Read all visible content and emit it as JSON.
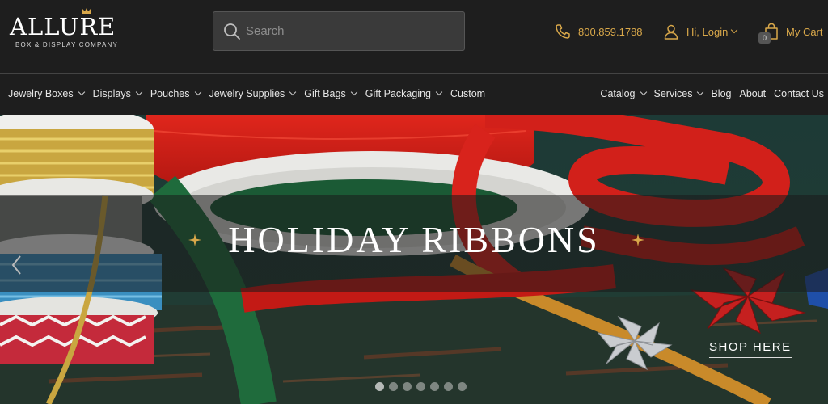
{
  "brand": {
    "name": "ALLURE",
    "tagline": "BOX & DISPLAY COMPANY",
    "accent_color": "#d9a84a"
  },
  "search": {
    "placeholder": "Search",
    "icon": "search-icon"
  },
  "header_utilities": {
    "phone": "800.859.1788",
    "login": "Hi, Login",
    "cart": "My Cart",
    "cart_count": "0"
  },
  "nav": {
    "left": [
      {
        "label": "Jewelry Boxes",
        "dropdown": true
      },
      {
        "label": "Displays",
        "dropdown": true
      },
      {
        "label": "Pouches",
        "dropdown": true
      },
      {
        "label": "Jewelry Supplies",
        "dropdown": true
      },
      {
        "label": "Gift Bags",
        "dropdown": true
      },
      {
        "label": "Gift Packaging",
        "dropdown": true
      },
      {
        "label": "Custom",
        "dropdown": false
      }
    ],
    "right": [
      {
        "label": "Catalog",
        "dropdown": true
      },
      {
        "label": "Services",
        "dropdown": true
      },
      {
        "label": "Blog",
        "dropdown": false
      },
      {
        "label": "About",
        "dropdown": false
      },
      {
        "label": "Contact Us",
        "dropdown": false
      }
    ]
  },
  "hero": {
    "title": "HOLIDAY RIBBONS",
    "cta": "SHOP HERE",
    "slides_total": 7,
    "active_slide": 1
  }
}
